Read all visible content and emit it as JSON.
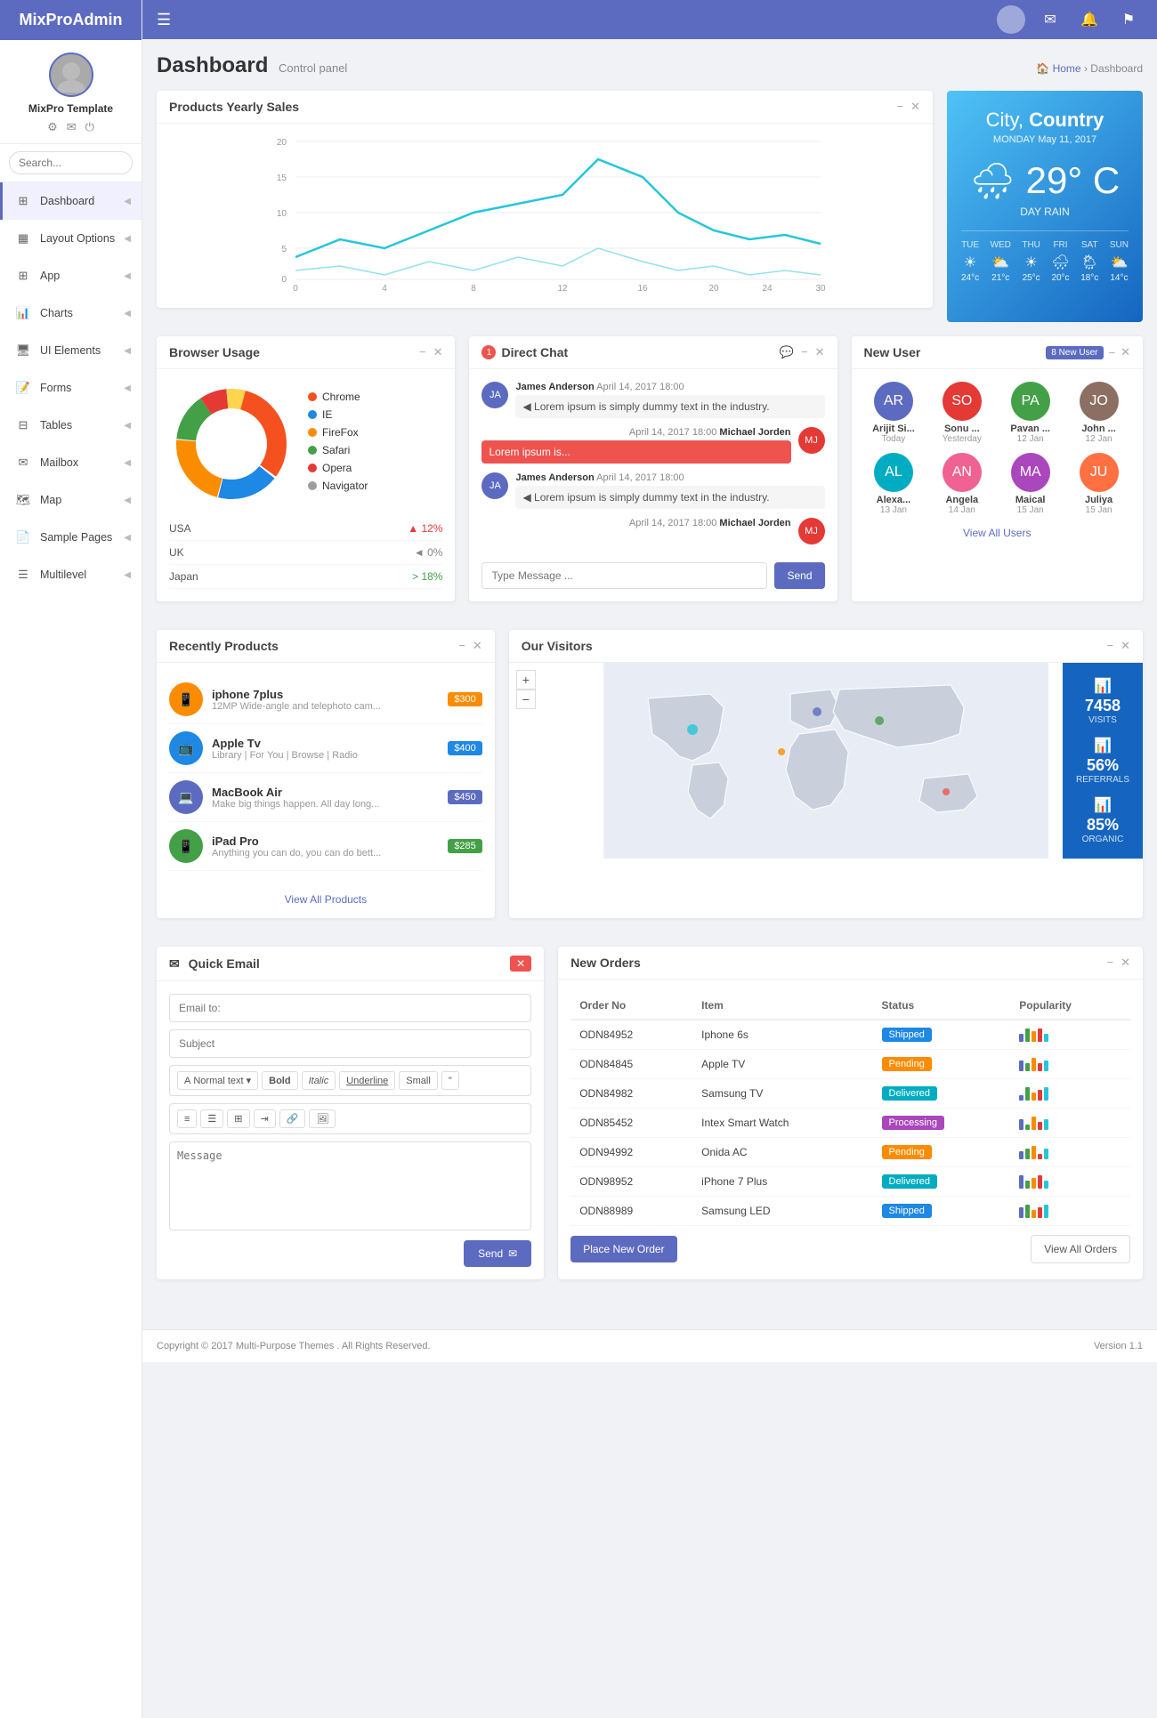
{
  "app": {
    "name": "MixPro",
    "name2": "Admin",
    "version": "Version 1.1",
    "copyright": "Copyright © 2017",
    "company": "Multi-Purpose Themes",
    "rights": ". All Rights Reserved."
  },
  "sidebar": {
    "profile": {
      "name": "MixPro Template",
      "icons": [
        "gear",
        "mail",
        "power"
      ]
    },
    "search_placeholder": "Search...",
    "nav_items": [
      {
        "label": "Dashboard",
        "icon": "dashboard",
        "active": true
      },
      {
        "label": "Layout Options",
        "icon": "layout"
      },
      {
        "label": "App",
        "icon": "app"
      },
      {
        "label": "Charts",
        "icon": "charts"
      },
      {
        "label": "UI Elements",
        "icon": "ui"
      },
      {
        "label": "Forms",
        "icon": "forms"
      },
      {
        "label": "Tables",
        "icon": "tables"
      },
      {
        "label": "Mailbox",
        "icon": "mailbox"
      },
      {
        "label": "Map",
        "icon": "map"
      },
      {
        "label": "Sample Pages",
        "icon": "pages"
      },
      {
        "label": "Multilevel",
        "icon": "multilevel"
      }
    ]
  },
  "header": {
    "title": "Dashboard",
    "subtitle": "Control panel",
    "breadcrumb_home": "Home",
    "breadcrumb_current": "Dashboard"
  },
  "weather": {
    "city": "City,",
    "country": "Country",
    "date_line": "MONDAY  May 11, 2017",
    "temp": "29°",
    "unit": "C",
    "desc": "DAY RAIN",
    "days": [
      {
        "label": "TUE",
        "icon": "☀",
        "temp": "24°c"
      },
      {
        "label": "WED",
        "icon": "⛅",
        "temp": "21°c"
      },
      {
        "label": "THU",
        "icon": "☀",
        "temp": "25°c"
      },
      {
        "label": "FRI",
        "icon": "🌧",
        "temp": "20°c"
      },
      {
        "label": "SAT",
        "icon": "🌦",
        "temp": "18°c"
      },
      {
        "label": "SUN",
        "icon": "⛅",
        "temp": "14°c"
      }
    ]
  },
  "sales_chart": {
    "title": "Products Yearly Sales",
    "x_labels": [
      "0",
      "4",
      "8",
      "12",
      "16",
      "20",
      "24",
      "30"
    ],
    "y_labels": [
      "0",
      "5",
      "10",
      "15",
      "20"
    ]
  },
  "browser_usage": {
    "title": "Browser Usage",
    "browsers": [
      {
        "name": "Chrome",
        "color": "#f4511e",
        "percent": 32
      },
      {
        "name": "IE",
        "color": "#1e88e5",
        "percent": 18
      },
      {
        "name": "FireFox",
        "color": "#fb8c00",
        "percent": 22
      },
      {
        "name": "Safari",
        "color": "#43a047",
        "percent": 14
      },
      {
        "name": "Opera",
        "color": "#e53935",
        "percent": 8
      },
      {
        "name": "Navigator",
        "color": "#9e9e9e",
        "percent": 6
      }
    ],
    "stats": [
      {
        "country": "USA",
        "change": "▲ 12%",
        "type": "up"
      },
      {
        "country": "UK",
        "change": "◄ 0%",
        "type": "flat"
      },
      {
        "country": "Japan",
        "change": "> 18%",
        "type": "down"
      }
    ]
  },
  "direct_chat": {
    "title": "Direct Chat",
    "badge": "1",
    "messages": [
      {
        "sender": "James Anderson",
        "time": "April 14, 2017 18:00",
        "text": "Lorem ipsum is simply dummy text in the industry.",
        "highlight": false,
        "dir": "left"
      },
      {
        "sender": "Michael Jorden",
        "time": "April 14, 2017 18:00",
        "text": "Lorem ipsum is...",
        "highlight": true,
        "dir": "right"
      },
      {
        "sender": "James Anderson",
        "time": "April 14, 2017 18:00",
        "text": "Lorem ipsum is simply dummy text in the industry.",
        "highlight": false,
        "dir": "left"
      },
      {
        "sender": "Michael Jorden",
        "time": "April 14, 2017 18:00",
        "text": "",
        "highlight": false,
        "dir": "right"
      }
    ],
    "input_placeholder": "Type Message ...",
    "send_label": "Send"
  },
  "new_user": {
    "title": "New User",
    "badge": "8 New User",
    "users": [
      {
        "name": "Arijit Si...",
        "date": "Today",
        "color": "#5c6bc0"
      },
      {
        "name": "Sonu ...",
        "date": "Yesterday",
        "color": "#e53935"
      },
      {
        "name": "Pavan ...",
        "date": "12 Jan",
        "color": "#43a047"
      },
      {
        "name": "John ...",
        "date": "12 Jan",
        "color": "#8d6e63"
      },
      {
        "name": "Alexa...",
        "date": "13 Jan",
        "color": "#00acc1"
      },
      {
        "name": "Angela",
        "date": "14 Jan",
        "color": "#f06292"
      },
      {
        "name": "Maical",
        "date": "15 Jan",
        "color": "#ab47bc"
      },
      {
        "name": "Juliya",
        "date": "15 Jan",
        "color": "#ff7043"
      }
    ],
    "view_all_label": "View All Users"
  },
  "recently_products": {
    "title": "Recently Products",
    "products": [
      {
        "name": "iphone 7plus",
        "desc": "12MP Wide-angle and telephoto cam...",
        "price": "$300",
        "color": "#fb8c00"
      },
      {
        "name": "Apple Tv",
        "desc": "Library | For You | Browse | Radio",
        "price": "$400",
        "color": "#1e88e5"
      },
      {
        "name": "MacBook Air",
        "desc": "Make big things happen. All day long...",
        "price": "$450",
        "color": "#5c6bc0"
      },
      {
        "name": "iPad Pro",
        "desc": "Anything you can do, you can do bett...",
        "price": "$285",
        "color": "#43a047"
      }
    ],
    "view_all_label": "View All Products"
  },
  "visitors": {
    "title": "Our Visitors",
    "stats": [
      {
        "num": "7458",
        "label": "VISITS",
        "icon": "📊"
      },
      {
        "num": "56%",
        "label": "REFERRALS",
        "icon": "📊"
      },
      {
        "num": "85%",
        "label": "ORGANIC",
        "icon": "📊"
      }
    ]
  },
  "quick_email": {
    "title": "Quick Email",
    "to_placeholder": "Email to:",
    "subject_placeholder": "Subject",
    "format_label": "Normal text",
    "bold_label": "Bold",
    "italic_label": "Italic",
    "underline_label": "Underline",
    "small_label": "Small",
    "message_placeholder": "Message",
    "send_label": "Send",
    "send_icon": "✉"
  },
  "new_orders": {
    "title": "New Orders",
    "columns": [
      "Order No",
      "Item",
      "Status",
      "Popularity"
    ],
    "orders": [
      {
        "order": "ODN84952",
        "item": "Iphone 6s",
        "status": "Shipped",
        "status_class": "badge-shipped",
        "pop": [
          3,
          5,
          4,
          5,
          3
        ]
      },
      {
        "order": "ODN84845",
        "item": "Apple TV",
        "status": "Pending",
        "status_class": "badge-pending",
        "pop": [
          4,
          3,
          5,
          3,
          4
        ]
      },
      {
        "order": "ODN84982",
        "item": "Samsung TV",
        "status": "Delivered",
        "status_class": "badge-delivered",
        "pop": [
          2,
          5,
          3,
          4,
          5
        ]
      },
      {
        "order": "ODN85452",
        "item": "Intex Smart Watch",
        "status": "Processing",
        "status_class": "badge-processing",
        "pop": [
          4,
          2,
          5,
          3,
          4
        ]
      },
      {
        "order": "ODN94992",
        "item": "Onida AC",
        "status": "Pending",
        "status_class": "badge-pending",
        "pop": [
          3,
          4,
          5,
          2,
          4
        ]
      },
      {
        "order": "ODN98952",
        "item": "iPhone 7 Plus",
        "status": "Delivered",
        "status_class": "badge-delivered",
        "pop": [
          5,
          3,
          4,
          5,
          3
        ]
      },
      {
        "order": "ODN88989",
        "item": "Samsung LED",
        "status": "Shipped",
        "status_class": "badge-shipped",
        "pop": [
          4,
          5,
          3,
          4,
          5
        ]
      }
    ],
    "place_order_label": "Place New Order",
    "view_all_label": "View All Orders"
  }
}
